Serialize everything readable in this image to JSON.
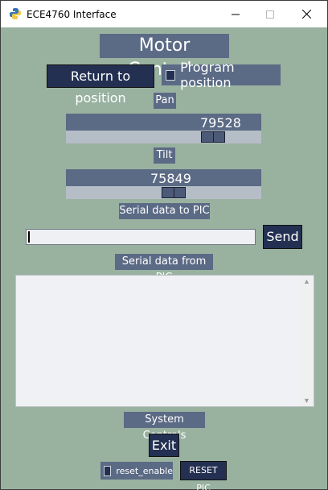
{
  "window": {
    "title": "ECE4760 Interface",
    "icon": "python-icon"
  },
  "heading": "Motor Controls",
  "buttons": {
    "return_position": "Return to position",
    "send": "Send",
    "exit": "Exit",
    "reset_pic": "RESET PIC"
  },
  "checkboxes": {
    "program_position": {
      "label": "Program position",
      "checked": false
    },
    "reset_enable": {
      "label": "reset_enable",
      "checked": false
    }
  },
  "pan": {
    "label": "Pan",
    "value": "79528",
    "fraction": 0.79
  },
  "tilt": {
    "label": "Tilt",
    "value": "75849",
    "fraction": 0.56
  },
  "serial_out": {
    "label": "Serial data to PIC",
    "value": ""
  },
  "serial_in": {
    "label": "Serial data from PIC",
    "value": ""
  },
  "system_controls": "System Controls",
  "colors": {
    "background": "#99b2a0",
    "label_bg": "#5b6a85",
    "button_bg": "#233052"
  }
}
